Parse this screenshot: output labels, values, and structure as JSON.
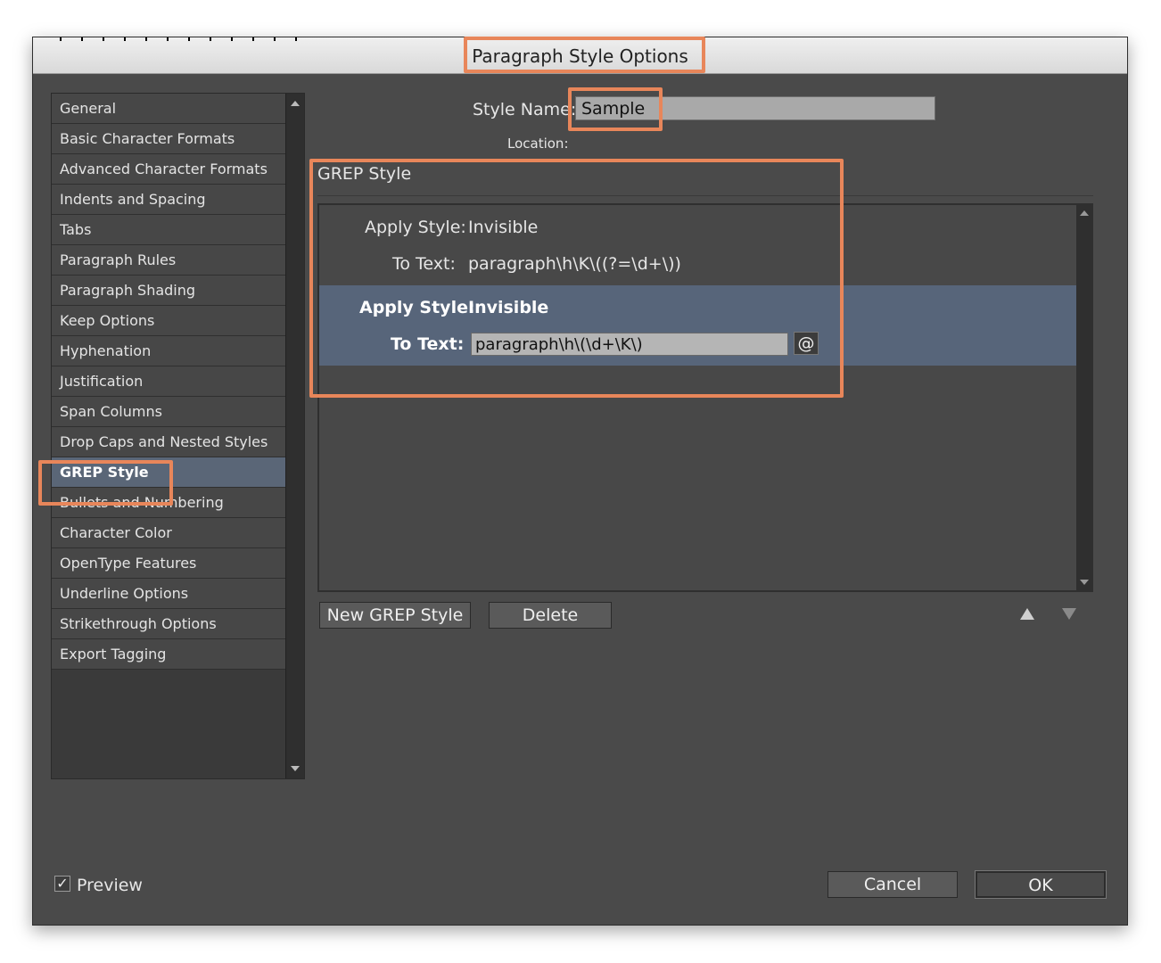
{
  "window": {
    "title": "Paragraph Style Options"
  },
  "sidebar": {
    "items": [
      {
        "label": "General"
      },
      {
        "label": "Basic Character Formats"
      },
      {
        "label": "Advanced Character Formats"
      },
      {
        "label": "Indents and Spacing"
      },
      {
        "label": "Tabs"
      },
      {
        "label": "Paragraph Rules"
      },
      {
        "label": "Paragraph Shading"
      },
      {
        "label": "Keep Options"
      },
      {
        "label": "Hyphenation"
      },
      {
        "label": "Justification"
      },
      {
        "label": "Span Columns"
      },
      {
        "label": "Drop Caps and Nested Styles"
      },
      {
        "label": "GREP Style",
        "selected": true
      },
      {
        "label": "Bullets and Numbering"
      },
      {
        "label": "Character Color"
      },
      {
        "label": "OpenType Features"
      },
      {
        "label": "Underline Options"
      },
      {
        "label": "Strikethrough Options"
      },
      {
        "label": "Export Tagging"
      }
    ]
  },
  "header": {
    "style_name_label": "Style Name:",
    "style_name_value": "Sample",
    "location_label": "Location:"
  },
  "section": {
    "title": "GREP Style"
  },
  "grep_styles": [
    {
      "apply_label": "Apply Style:",
      "apply_value": "Invisible",
      "text_label": "To Text:",
      "text_value": "paragraph\\h\\K\\((?=\\d+\\))",
      "selected": false
    },
    {
      "apply_label": "Apply Style:",
      "apply_value": "Invisible",
      "text_label": "To Text:",
      "text_value": "paragraph\\h\\(\\d+\\K\\)",
      "selected": true
    }
  ],
  "special_char_button": "@",
  "buttons": {
    "new_grep": "New GREP Style",
    "delete": "Delete",
    "cancel": "Cancel",
    "ok": "OK"
  },
  "preview": {
    "label": "Preview",
    "checked": true,
    "check_glyph": "✓"
  },
  "colors": {
    "highlight": "#e8865a",
    "selection": "#5a6677"
  }
}
